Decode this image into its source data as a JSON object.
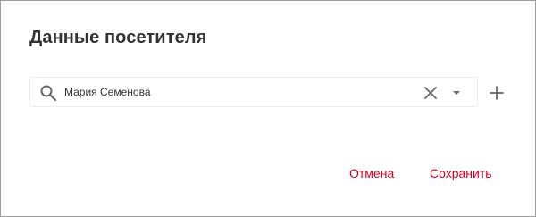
{
  "dialog": {
    "title": "Данные посетителя",
    "search": {
      "value": "Мария Семенова",
      "icon": "search-icon",
      "clear_icon": "close-icon",
      "dropdown_icon": "caret-down-icon"
    },
    "add_icon": "plus-icon",
    "actions": {
      "cancel_label": "Отмена",
      "save_label": "Сохранить"
    }
  },
  "colors": {
    "accent": "#d50022",
    "title": "#333333",
    "border": "#9e9e9e",
    "icon": "#666666"
  }
}
